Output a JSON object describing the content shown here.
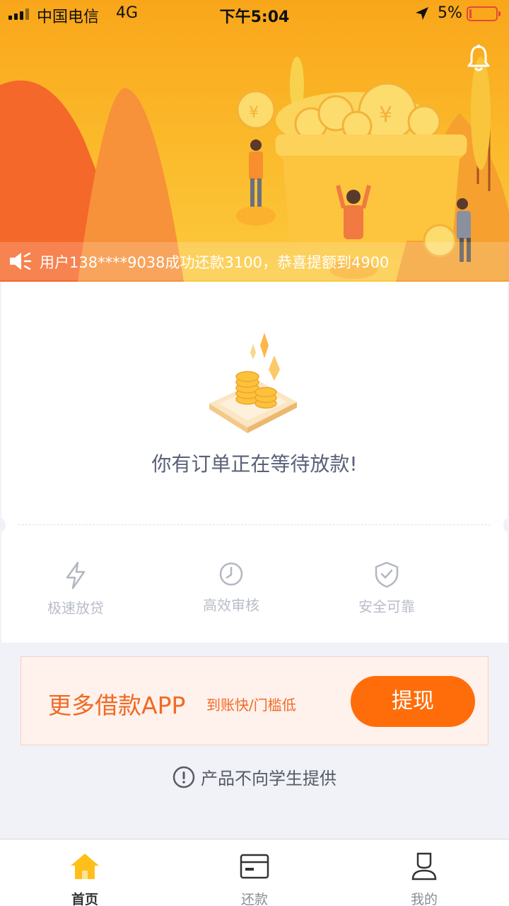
{
  "status_bar": {
    "carrier": "中国电信",
    "network": "4G",
    "time": "下午5:04",
    "battery": "5%"
  },
  "hero": {
    "notice_text": "用户138****9038成功还款3100，恭喜提额到4900",
    "bell_icon": "bell-icon",
    "coin_symbol": "¥"
  },
  "status_card": {
    "message": "你有订单正在等待放款!",
    "features": [
      {
        "label": "极速放贷",
        "icon": "lightning-icon"
      },
      {
        "label": "高效审核",
        "icon": "clock-icon"
      },
      {
        "label": "安全可靠",
        "icon": "shield-check-icon"
      }
    ]
  },
  "promo": {
    "title": "更多借款APP",
    "subtitle": "到账快/门槛低",
    "button_label": "提现"
  },
  "warning": {
    "text": "产品不向学生提供",
    "icon": "exclamation-circle-icon"
  },
  "tabbar": {
    "tabs": [
      {
        "label": "首页",
        "icon": "home-icon",
        "active": true
      },
      {
        "label": "还款",
        "icon": "card-icon",
        "active": false
      },
      {
        "label": "我的",
        "icon": "user-icon",
        "active": false
      }
    ]
  },
  "colors": {
    "accent": "#ff6d0a",
    "hero_orange": "#f9a61a",
    "active_tab": "#ffbf1a"
  }
}
